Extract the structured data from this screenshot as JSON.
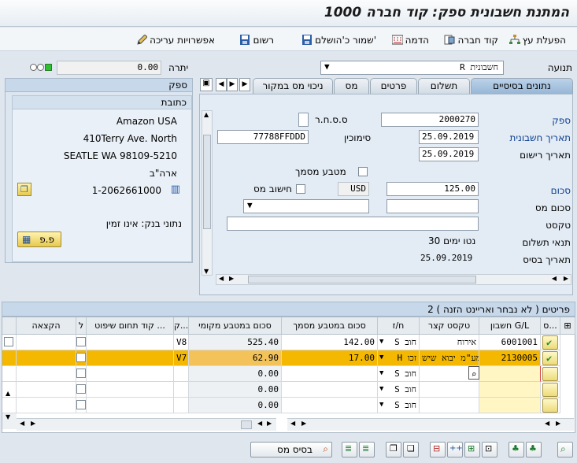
{
  "window": {
    "title": "המתנת חשבונית ספק: קוד חברה 1000"
  },
  "toolbar": {
    "items": [
      "הפעלת עץ",
      "קוד חברה",
      "הדמה",
      "שמור כ'הושלם'",
      "רשום",
      "אפשרויות עריכה"
    ]
  },
  "header": {
    "transaction_label": "תנועה",
    "transaction_value": "R חשבונית",
    "balance_label": "יתרה",
    "balance_value": "0.00"
  },
  "vendor": {
    "title": "ספק",
    "address_title": "כתובת",
    "name": "Amazon USA",
    "street": "410Terry Ave. North",
    "city": "SEATLE WA  98109-5210",
    "country": "ארה\"ב",
    "phone": "1-2062661000",
    "bank_label": "נתוני בנק: אינו זמין",
    "btn": "פ.פ"
  },
  "tabs": [
    "נתונים בסיסיים",
    "תשלום",
    "פרטים",
    "מס",
    "ניכוי מס במקור"
  ],
  "form": {
    "vendor_label": "ספק",
    "vendor_value": "2000270",
    "invoice_date_label": "תאריך חשבונית",
    "invoice_date": "25.09.2019",
    "posting_date_label": "תאריך רישום",
    "posting_date": "25.09.2019",
    "ssh_label": "ס.ס.ח.ר",
    "reference_label": "סימוכין",
    "reference_value": "77788FFDDD",
    "doc_currency_label": "מטבע מסמך",
    "amount_label": "סכום",
    "amount_value": "125.00",
    "currency": "USD",
    "calc_tax_label": "חישוב מס",
    "tax_amount_label": "סכום מס",
    "text_label": "טקסט",
    "payment_terms_label": "תנאי תשלום",
    "payment_terms_value": "30 נטו ימים",
    "baseline_label": "תאריך בסיס",
    "baseline_value": "25.09.2019"
  },
  "grid": {
    "title": "2 פריטים ( לא נבחר ואריינט הזנה )",
    "headers": [
      "ס...",
      "חשבון G/L",
      "טקסט קצר",
      "ח/ז",
      "סכום במטבע מסמך",
      "סכום במטבע מקומי",
      "ק...",
      "קוד תחום שיפוט ...",
      "ל",
      "הקצאה"
    ],
    "rows": [
      {
        "account": "6001001",
        "text": "אירוח",
        "dc": "S חוב",
        "amount_doc": "142.00",
        "amount_loc": "525.40",
        "tax": "V8"
      },
      {
        "account": "2130005",
        "text": "מע\"מ יבוא שיש H זכו",
        "dc": "H זכו",
        "amount_doc": "17.00",
        "amount_loc": "62.90",
        "tax": "V7"
      },
      {
        "account": "",
        "text": "",
        "dc": "S חוב",
        "amount_doc": "",
        "amount_loc": "0.00",
        "tax": ""
      },
      {
        "account": "",
        "text": "",
        "dc": "S חוב",
        "amount_doc": "",
        "amount_loc": "0.00",
        "tax": ""
      },
      {
        "account": "",
        "text": "",
        "dc": "S חוב",
        "amount_doc": "",
        "amount_loc": "0.00",
        "tax": ""
      }
    ]
  },
  "footer": {
    "tax_base_button": "בסיס מס"
  },
  "colors": {
    "selected_row": "#f5b800",
    "link_blue": "#0a3d8f"
  }
}
